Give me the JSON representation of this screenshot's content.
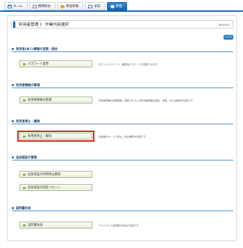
{
  "nav": {
    "tabs": [
      {
        "label": "ホーム",
        "icon": "home-icon"
      },
      {
        "label": "明細照会",
        "icon": "statement-icon"
      },
      {
        "label": "資金移動",
        "icon": "yen-transfer-icon"
      },
      {
        "label": "承認",
        "icon": "approve-icon"
      },
      {
        "label": "管理",
        "icon": "gear-icon",
        "active": true
      }
    ]
  },
  "header": {
    "title": "利用者管理 》 作業内容選択",
    "screen_id": "BRGK001",
    "help_label": "ヘルプ"
  },
  "sections": [
    {
      "title": "利用者(本人)情報の変更・照会",
      "items": [
        {
          "label": "パスワード変更",
          "desc": "ログインパスワード、確認用パスワードを変更できます。"
        }
      ]
    },
    {
      "title": "利用者情報の管理",
      "items": [
        {
          "label": "利用者情報の管理",
          "desc": "利用者情報の新規登録、登録されている利用者情報の照会、変更、または削除が可能です。"
        }
      ]
    },
    {
      "title": "利用者停止・解除",
      "items": [
        {
          "label": "利用者停止・解除",
          "desc": "利用者のサービス停止、停止解除が可能です。",
          "selected": true
        }
      ]
    },
    {
      "title": "追加認証の管理",
      "items": [
        {
          "label": "追加認証の利用停止解除",
          "desc": ""
        },
        {
          "label": "追加認証の回答リセット",
          "desc": ""
        }
      ]
    },
    {
      "title": "証明書失効",
      "items": [
        {
          "label": "証明書失効",
          "desc": "クライアント証明書の失効が可能です。"
        }
      ]
    }
  ],
  "colors": {
    "accent": "#1565b0",
    "highlight": "#d22020"
  }
}
